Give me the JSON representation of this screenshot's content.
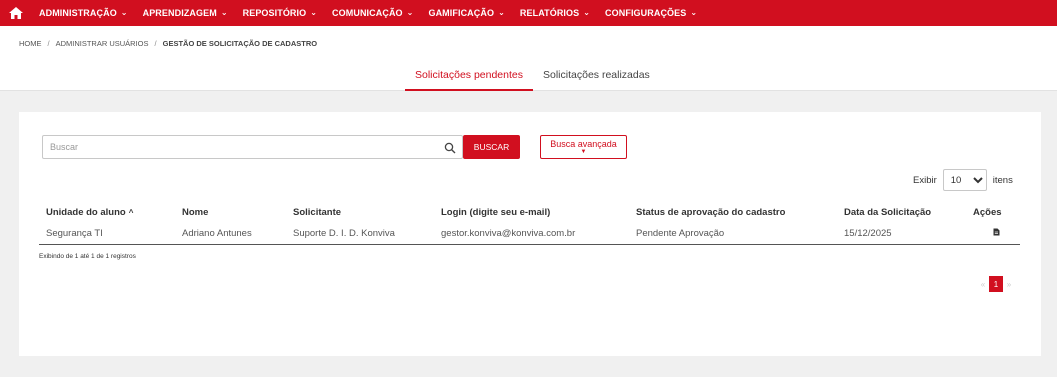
{
  "colors": {
    "brand": "#d10f1f"
  },
  "nav": {
    "home_icon": "home-icon",
    "items": [
      {
        "label": "ADMINISTRAÇÃO"
      },
      {
        "label": "APRENDIZAGEM"
      },
      {
        "label": "REPOSITÓRIO"
      },
      {
        "label": "COMUNICAÇÃO"
      },
      {
        "label": "GAMIFICAÇÃO"
      },
      {
        "label": "RELATÓRIOS"
      },
      {
        "label": "CONFIGURAÇÕES"
      }
    ]
  },
  "breadcrumb": {
    "items": [
      "HOME",
      "ADMINISTRAR USUÁRIOS",
      "GESTÃO DE SOLICITAÇÃO DE CADASTRO"
    ],
    "separator": "/"
  },
  "tabs": [
    {
      "label": "Solicitações pendentes",
      "active": true
    },
    {
      "label": "Solicitações realizadas",
      "active": false
    }
  ],
  "search": {
    "placeholder": "Buscar",
    "value": "",
    "button_label": "BUSCAR",
    "advanced_label": "Busca avançada"
  },
  "pagesize": {
    "before": "Exibir",
    "selected": "10",
    "after": "itens"
  },
  "table": {
    "columns": [
      "Unidade do aluno",
      "Nome",
      "Solicitante",
      "Login (digite seu e-mail)",
      "Status de aprovação do cadastro",
      "Data da Solicitação",
      "Ações"
    ],
    "rows": [
      [
        "Segurança TI",
        "Adriano Antunes",
        "Suporte D. I. D. Konviva",
        "gestor.konviva@konviva.com.br",
        "Pendente Aprovação",
        "15/12/2025"
      ]
    ]
  },
  "info": "Exibindo de 1 até 1 de 1 registros",
  "pagination": {
    "current": "1",
    "prev": "«",
    "next": "»"
  }
}
